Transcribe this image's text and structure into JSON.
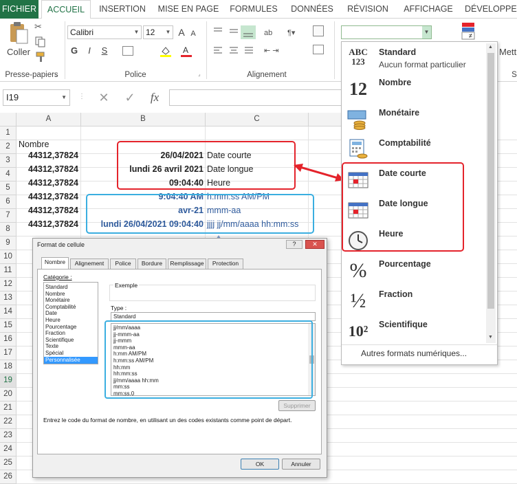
{
  "tabs": [
    "FICHIER",
    "ACCUEIL",
    "INSERTION",
    "MISE EN PAGE",
    "FORMULES",
    "DONNÉES",
    "RÉVISION",
    "AFFICHAGE",
    "DÉVELOPPEU"
  ],
  "ribbon": {
    "clipboard": {
      "paste_label": "Coller",
      "group_label": "Presse-papiers"
    },
    "font": {
      "name": "Calibri",
      "size": "12",
      "grow": "A",
      "shrink": "A",
      "bold": "G",
      "italic": "I",
      "underline": "S",
      "group_label": "Police"
    },
    "alignment": {
      "group_label": "Alignement"
    },
    "number": {
      "format_value": ""
    },
    "right_group": {
      "partial_label": "Mett",
      "partial_group": "S"
    }
  },
  "formula_bar": {
    "name_box": "I19",
    "fx": "fx",
    "cancel": "✕",
    "enter": "✓",
    "formula": ""
  },
  "grid": {
    "columns": [
      "A",
      "B",
      "C"
    ],
    "rows": [
      "1",
      "2",
      "3",
      "4",
      "5",
      "6",
      "7",
      "8",
      "9",
      "10",
      "11",
      "12",
      "13",
      "14",
      "15",
      "16",
      "17",
      "18",
      "19",
      "20",
      "21",
      "22",
      "23",
      "24",
      "25",
      "26"
    ],
    "header_a2": "Nombre",
    "values": [
      {
        "a": "44312,37824",
        "b": "26/04/2021",
        "c": "Date courte"
      },
      {
        "a": "44312,37824",
        "b": "lundi 26 avril 2021",
        "c": "Date longue"
      },
      {
        "a": "44312,37824",
        "b": "09:04:40",
        "c": "Heure"
      },
      {
        "a": "44312,37824",
        "b": "9:04:40 AM",
        "c": "h:mm:ss AM/PM"
      },
      {
        "a": "44312,37824",
        "b": "avr-21",
        "c": "mmm-aa"
      },
      {
        "a": "44312,37824",
        "b": "lundi 26/04/2021 09:04:40",
        "c": "jjjj jj/mm/aaaa hh:mm:ss"
      }
    ]
  },
  "format_dropdown": {
    "items": [
      {
        "title": "Standard",
        "subtitle": "Aucun format particulier",
        "icon": "abc-123-icon",
        "glyph": "ABC\n123"
      },
      {
        "title": "Nombre",
        "subtitle": "",
        "icon": "number-12-icon",
        "glyph": "12"
      },
      {
        "title": "Monétaire",
        "subtitle": "",
        "icon": "currency-icon",
        "glyph": ""
      },
      {
        "title": "Comptabilité",
        "subtitle": "",
        "icon": "accounting-icon",
        "glyph": ""
      },
      {
        "title": "Date courte",
        "subtitle": "",
        "icon": "calendar-icon",
        "glyph": ""
      },
      {
        "title": "Date longue",
        "subtitle": "",
        "icon": "calendar-icon",
        "glyph": ""
      },
      {
        "title": "Heure",
        "subtitle": "",
        "icon": "clock-icon",
        "glyph": ""
      },
      {
        "title": "Pourcentage",
        "subtitle": "",
        "icon": "percent-icon",
        "glyph": "%"
      },
      {
        "title": "Fraction",
        "subtitle": "",
        "icon": "fraction-icon",
        "glyph": "½"
      },
      {
        "title": "Scientifique",
        "subtitle": "",
        "icon": "scientific-icon",
        "glyph": "10²"
      }
    ],
    "more_formats": "Autres formats numériques..."
  },
  "dialog": {
    "title": "Format de cellule",
    "help": "?",
    "close": "✕",
    "tabs": [
      "Nombre",
      "Alignement",
      "Police",
      "Bordure",
      "Remplissage",
      "Protection"
    ],
    "category_label": "Catégorie :",
    "categories": [
      "Standard",
      "Nombre",
      "Monétaire",
      "Comptabilité",
      "Date",
      "Heure",
      "Pourcentage",
      "Fraction",
      "Scientifique",
      "Texte",
      "Spécial",
      "Personnalisée"
    ],
    "selected_category": "Personnalisée",
    "example_label": "Exemple",
    "type_label": "Type :",
    "type_value": "Standard",
    "type_list": [
      "jj/mm/aaaa",
      "jj-mmm-aa",
      "jj-mmm",
      "mmm-aa",
      "h:mm AM/PM",
      "h:mm:ss AM/PM",
      "hh:mm",
      "hh:mm:ss",
      "jj/mm/aaaa hh:mm",
      "mm:ss",
      "mm:ss,0"
    ],
    "delete_label": "Supprimer",
    "hint": "Entrez le code du format de nombre, en utilisant un des codes existants comme point de départ.",
    "ok": "OK",
    "cancel": "Annuler"
  },
  "colors": {
    "excel_green": "#217346",
    "red_annotation": "#e4232b",
    "blue_annotation": "#3aaee0",
    "arrow": "#7f9bc7",
    "cell_blue_text": "#2e5a9c"
  }
}
